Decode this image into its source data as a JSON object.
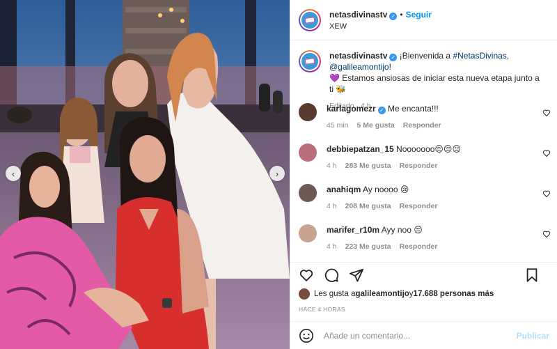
{
  "header": {
    "username": "netasdivinastv",
    "separator": "•",
    "follow_label": "Seguir",
    "location": "XEW"
  },
  "caption": {
    "username": "netasdivinastv",
    "text_before": " ¡Bienvenida a ",
    "hashtag": "#NetasDivinas",
    "text_mid": ", ",
    "mention": "@galileamontijo",
    "text_after": "!",
    "line2": "💜 Estamos ansiosas de iniciar esta nueva etapa junto a ti 🐝",
    "meta": "Editado · 4 h"
  },
  "comments": [
    {
      "username": "karlagomezr",
      "verified": true,
      "text": " Me encanta!!!",
      "time": "45 min",
      "likes": "5 Me gusta",
      "reply": "Responder"
    },
    {
      "username": "debbiepatzan_15",
      "verified": false,
      "text": " Nooooooo😔😔😔",
      "time": "4 h",
      "likes": "283 Me gusta",
      "reply": "Responder"
    },
    {
      "username": "anahiqm",
      "verified": false,
      "text": " Ay noooo 😢",
      "time": "4 h",
      "likes": "208 Me gusta",
      "reply": "Responder"
    },
    {
      "username": "marifer_r10m",
      "verified": false,
      "text": " Ayy noo 😔",
      "time": "4 h",
      "likes": "223 Me gusta",
      "reply": "Responder"
    }
  ],
  "likes": {
    "prefix": "Les gusta a ",
    "user": "galileamontijo",
    "mid": " y ",
    "count": "17.688 personas más"
  },
  "timestamp": "HACE 4 HORAS",
  "add_comment": {
    "placeholder": "Añade un comentario...",
    "publish_label": "Publicar"
  },
  "colors": {
    "link_blue": "#0095f6",
    "hashtag": "#00376b",
    "muted": "#8e8e8e",
    "publish_disabled": "#b2dffc"
  },
  "icons": [
    "heart-icon",
    "comment-icon",
    "share-icon",
    "bookmark-icon",
    "emoji-icon",
    "verified-icon",
    "chevron-left-icon",
    "chevron-right-icon"
  ]
}
